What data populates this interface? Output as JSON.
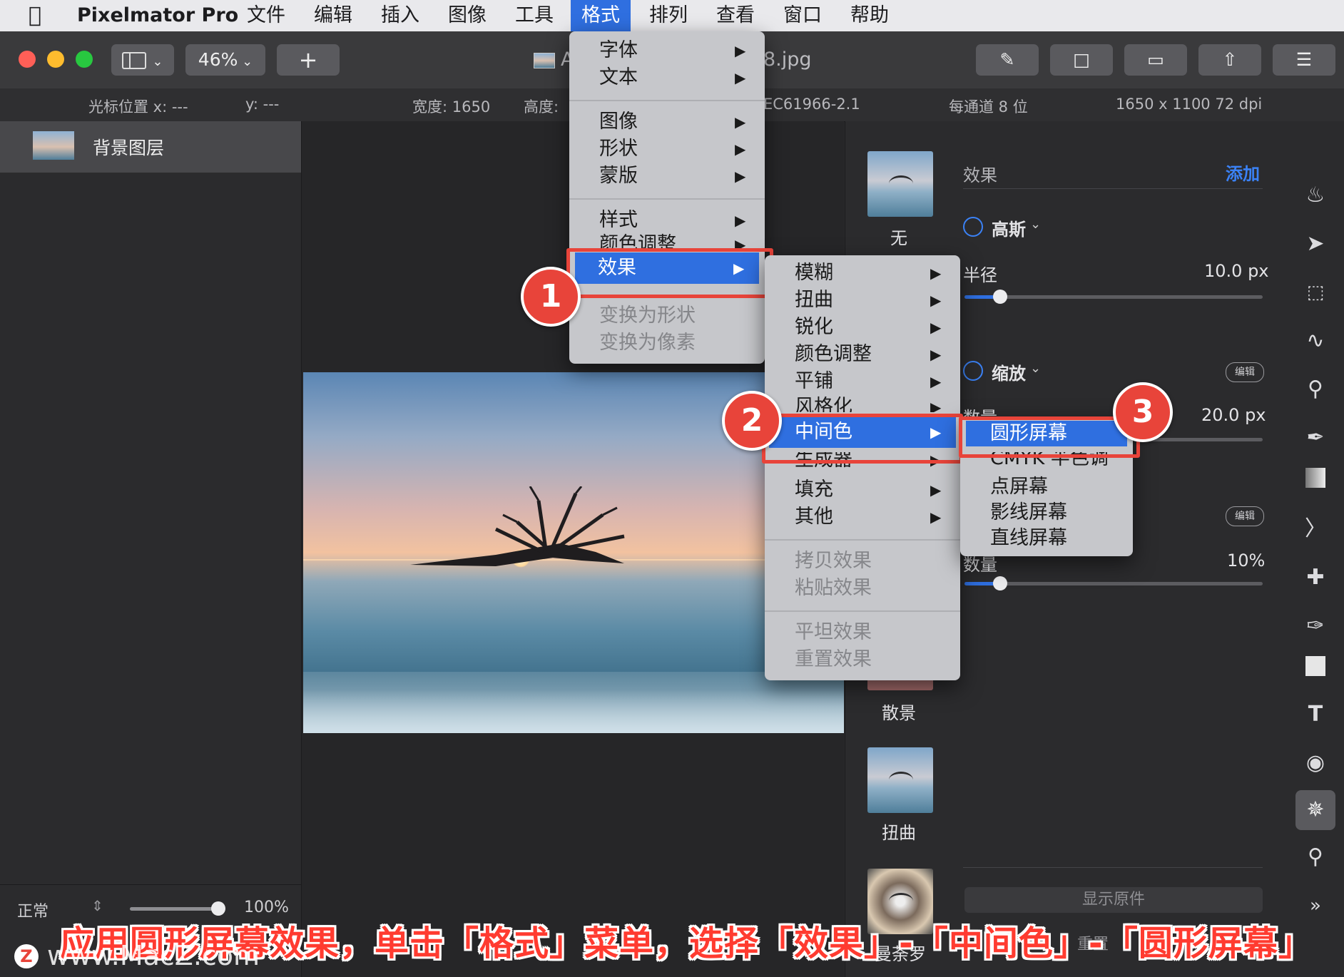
{
  "menubar": {
    "app_name": "Pixelmator Pro",
    "items": [
      "文件",
      "编辑",
      "插入",
      "图像",
      "工具",
      "格式",
      "排列",
      "查看",
      "窗口",
      "帮助"
    ],
    "active": "格式"
  },
  "toolbar": {
    "zoom": "46%",
    "plus": "+",
    "doc_title_prefix": "A",
    "doc_title_suffix": "8.jpg"
  },
  "infobar": {
    "cursor_x": "光标位置 x:  ---",
    "cursor_y": "y:  ---",
    "width": "宽度:  1650",
    "height": "高度:",
    "profile": "EC61966-2.1",
    "depth": "每通道 8 位",
    "size": "1650 x 1100 72 dpi"
  },
  "layers": {
    "name": "背景图层",
    "blend_mode": "正常",
    "opacity": "100%"
  },
  "right_panel": {
    "header": "效果",
    "add": "添加",
    "thumbs": [
      "无",
      "散景",
      "扭曲",
      "曼荼罗"
    ],
    "gauss": "高斯",
    "radius_label": "半径",
    "radius_value": "10.0 px",
    "radius_fraction": 0.12,
    "zoom_label": "缩放",
    "edit1": "编辑",
    "amount_label_cut": "数量",
    "amount_value": "20.0 px",
    "edit2": "编辑",
    "amount2_label": "数量",
    "amount2_value": "10%",
    "amount2_fraction": 0.12,
    "show_original": "显示原件",
    "reset_cut": "重置"
  },
  "format_menu": {
    "items": [
      {
        "label": "字体",
        "arrow": "▶"
      },
      {
        "label": "文本",
        "arrow": "▶"
      },
      {
        "label": "图像",
        "arrow": "▶"
      },
      {
        "label": "形状",
        "arrow": "▶"
      },
      {
        "label": "蒙版",
        "arrow": "▶"
      },
      {
        "label": "样式",
        "arrow": "▶"
      },
      {
        "label": "颜色调整",
        "arrow": "▶"
      },
      {
        "label": "效果",
        "arrow": "▶"
      },
      {
        "label": "变换为形状"
      },
      {
        "label": "变换为像素"
      }
    ]
  },
  "effects_menu": {
    "items": [
      {
        "label": "模糊",
        "arrow": "▶"
      },
      {
        "label": "扭曲",
        "arrow": "▶"
      },
      {
        "label": "锐化",
        "arrow": "▶"
      },
      {
        "label": "颜色调整",
        "arrow": "▶"
      },
      {
        "label": "平铺",
        "arrow": "▶"
      },
      {
        "label": "风格化",
        "arrow": "▶"
      },
      {
        "label": "中间色",
        "arrow": "▶"
      },
      {
        "label": "生成器",
        "arrow": "▶"
      },
      {
        "label": "填充",
        "arrow": "▶"
      },
      {
        "label": "其他",
        "arrow": "▶"
      },
      {
        "label": "拷贝效果"
      },
      {
        "label": "粘贴效果"
      },
      {
        "label": "平坦效果"
      },
      {
        "label": "重置效果"
      }
    ]
  },
  "halftone_menu": {
    "items": [
      "圆形屏幕",
      "CMYK 半色调",
      "点屏幕",
      "影线屏幕",
      "直线屏幕"
    ]
  },
  "badges": [
    "1",
    "2",
    "3"
  ],
  "caption": "应用圆形屏幕效果，单击「格式」菜单，选择「效果」-「中间色」-「圆形屏幕」",
  "watermark": "www.MacZ.com",
  "watermark_logo": "Z"
}
